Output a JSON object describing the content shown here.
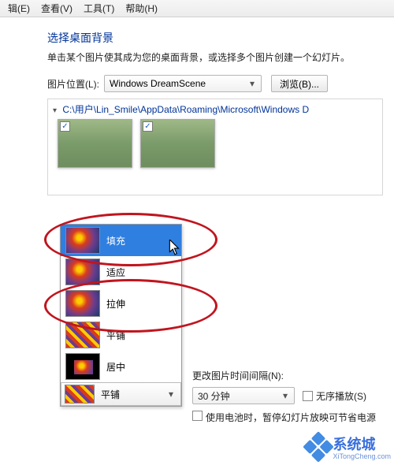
{
  "menubar": {
    "m1": "辑(E)",
    "m2": "查看(V)",
    "m3": "工具(T)",
    "m4": "帮助(H)"
  },
  "header": {
    "title": "选择桌面背景",
    "subtitle": "单击某个图片使其成为您的桌面背景，或选择多个图片创建一个幻灯片。"
  },
  "location": {
    "label": "图片位置(L):",
    "value": "Windows DreamScene",
    "browse": "浏览(B)..."
  },
  "path": "C:\\用户\\Lin_Smile\\AppData\\Roaming\\Microsoft\\Windows D",
  "thumbs": [
    {
      "checked": true
    },
    {
      "checked": true
    }
  ],
  "position_options": {
    "o1": "填充",
    "o2": "适应",
    "o3": "拉伸",
    "o4": "平铺",
    "o5": "居中"
  },
  "position_selected": "平铺",
  "timing": {
    "label": "更改图片时间间隔(N):",
    "value": "30 分钟",
    "shuffle": "无序播放(S)",
    "battery": "使用电池时，暂停幻灯片放映可节省电源"
  },
  "brand": "系统城",
  "brand_sub": "XiTongCheng.com"
}
